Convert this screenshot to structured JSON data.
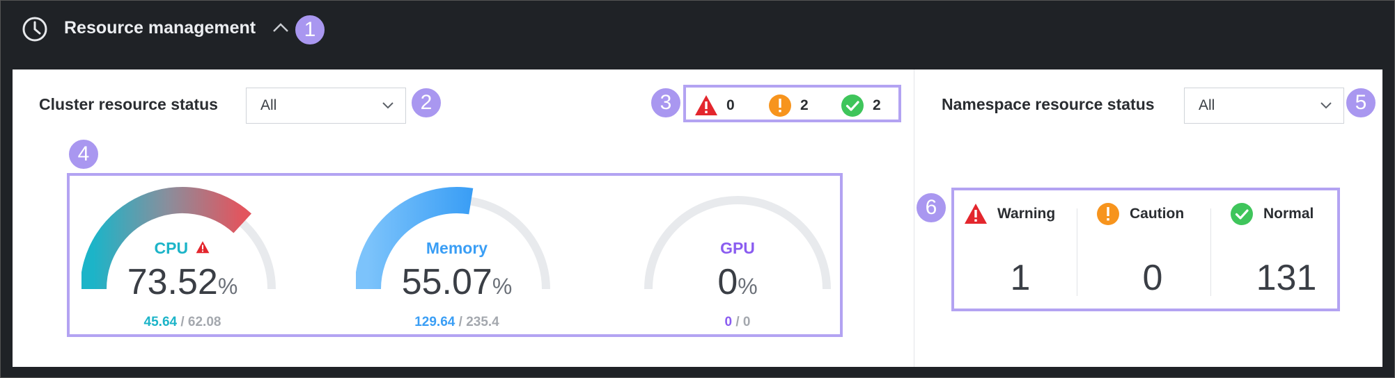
{
  "header": {
    "title": "Resource management",
    "icon": "clock-icon"
  },
  "callouts": [
    "1",
    "2",
    "3",
    "4",
    "5",
    "6"
  ],
  "cluster": {
    "title": "Cluster resource status",
    "filter_value": "All",
    "summary": [
      {
        "status": "warning",
        "icon": "warning-icon",
        "count": "0",
        "color": "#e3262d"
      },
      {
        "status": "caution",
        "icon": "caution-icon",
        "count": "2",
        "color": "#f7941d"
      },
      {
        "status": "normal",
        "icon": "normal-icon",
        "count": "2",
        "color": "#3fc55b"
      }
    ],
    "gauges": [
      {
        "name": "CPU",
        "value": "73.52",
        "pct": "%",
        "used": "45.64",
        "total": "62.08",
        "fill": 0.7352,
        "label_color": "#1cb4c8",
        "alert": true
      },
      {
        "name": "Memory",
        "value": "55.07",
        "pct": "%",
        "used": "129.64",
        "total": "235.4",
        "fill": 0.5507,
        "label_color": "#3a9ef5",
        "alert": false
      },
      {
        "name": "GPU",
        "value": "0",
        "pct": "%",
        "used": "0",
        "total": "0",
        "fill": 0,
        "label_color": "#8a5cf0",
        "alert": false
      }
    ]
  },
  "namespace": {
    "title": "Namespace resource status",
    "filter_value": "All",
    "statuses": [
      {
        "label": "Warning",
        "icon": "warning-icon",
        "count": "1"
      },
      {
        "label": "Caution",
        "icon": "caution-icon",
        "count": "0"
      },
      {
        "label": "Normal",
        "icon": "normal-icon",
        "count": "131"
      }
    ]
  },
  "colors": {
    "accent_callout": "#a997f0",
    "highlight_border": "#b3a3f2",
    "track": "#e8eaed"
  }
}
